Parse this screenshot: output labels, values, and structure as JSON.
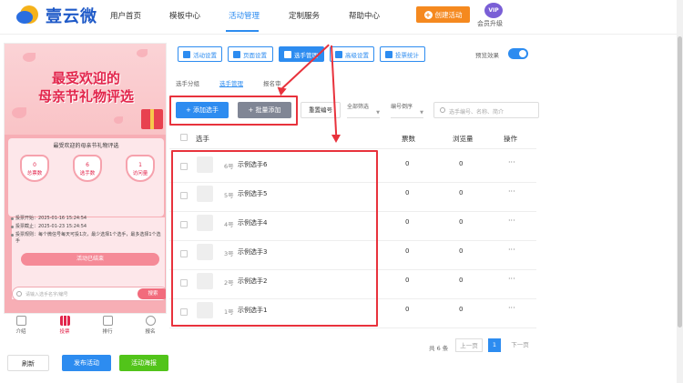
{
  "brand": {
    "name": "壹云微"
  },
  "nav": {
    "items": [
      "用户首页",
      "模板中心",
      "活动管理",
      "定制服务",
      "帮助中心"
    ],
    "create_label": "创建活动",
    "vip_badge": "VIP",
    "vip_label": "会员升级"
  },
  "preview": {
    "title_line1": "最受欢迎的",
    "title_line2": "母亲节礼物评选",
    "subtitle": "最受欢迎的母亲节礼物评选",
    "stats": [
      {
        "num": "0",
        "label": "总票数"
      },
      {
        "num": "6",
        "label": "选手数"
      },
      {
        "num": "1",
        "label": "访问量"
      }
    ],
    "info": [
      "投票开始：2025-01-16 15:24:54",
      "投票截止：2025-01-23 15:24:54",
      "投票规则：每个微信号每天可投1次，最少选择1个选手，最多选择1个选手"
    ],
    "ended_label": "活动已结束",
    "search_placeholder": "请输入选手名字/编号",
    "search_button": "搜索",
    "tabs": [
      "介绍",
      "投票",
      "排行",
      "报名"
    ]
  },
  "bottom_buttons": {
    "refresh": "刷新",
    "publish": "发布活动",
    "poster": "活动海报"
  },
  "toolbar": {
    "items": [
      "活动设置",
      "页面设置",
      "选手管理",
      "高级设置",
      "投票统计"
    ],
    "preview_label": "预览效果"
  },
  "subtabs": [
    "选手分组",
    "选手管理",
    "报名审"
  ],
  "actions": {
    "add": "+ 添加选手",
    "batch": "+ 批量添加",
    "reset": "重置编号",
    "filter": "全部筛选",
    "sort": "编号倒序",
    "search_placeholder": "选手编号、名称、简介"
  },
  "table": {
    "headers": {
      "player": "选手",
      "votes": "票数",
      "views": "浏览量",
      "ops": "操作"
    },
    "rows": [
      {
        "no": "6号",
        "name": "示例选手6",
        "votes": "0",
        "views": "0",
        "ops": "···"
      },
      {
        "no": "5号",
        "name": "示例选手5",
        "votes": "0",
        "views": "0",
        "ops": "···"
      },
      {
        "no": "4号",
        "name": "示例选手4",
        "votes": "0",
        "views": "0",
        "ops": "···"
      },
      {
        "no": "3号",
        "name": "示例选手3",
        "votes": "0",
        "views": "0",
        "ops": "···"
      },
      {
        "no": "2号",
        "name": "示例选手2",
        "votes": "0",
        "views": "0",
        "ops": "···"
      },
      {
        "no": "1号",
        "name": "示例选手1",
        "votes": "0",
        "views": "0",
        "ops": "···"
      }
    ]
  },
  "pagination": {
    "total": "共 6 条",
    "prev": "上一页",
    "current": "1",
    "next": "下一页"
  },
  "colors": {
    "accent": "#2d8cf0",
    "highlight": "#e8323c",
    "create": "#f5891f",
    "publish": "#2d8cf0",
    "poster": "#52c41a"
  }
}
